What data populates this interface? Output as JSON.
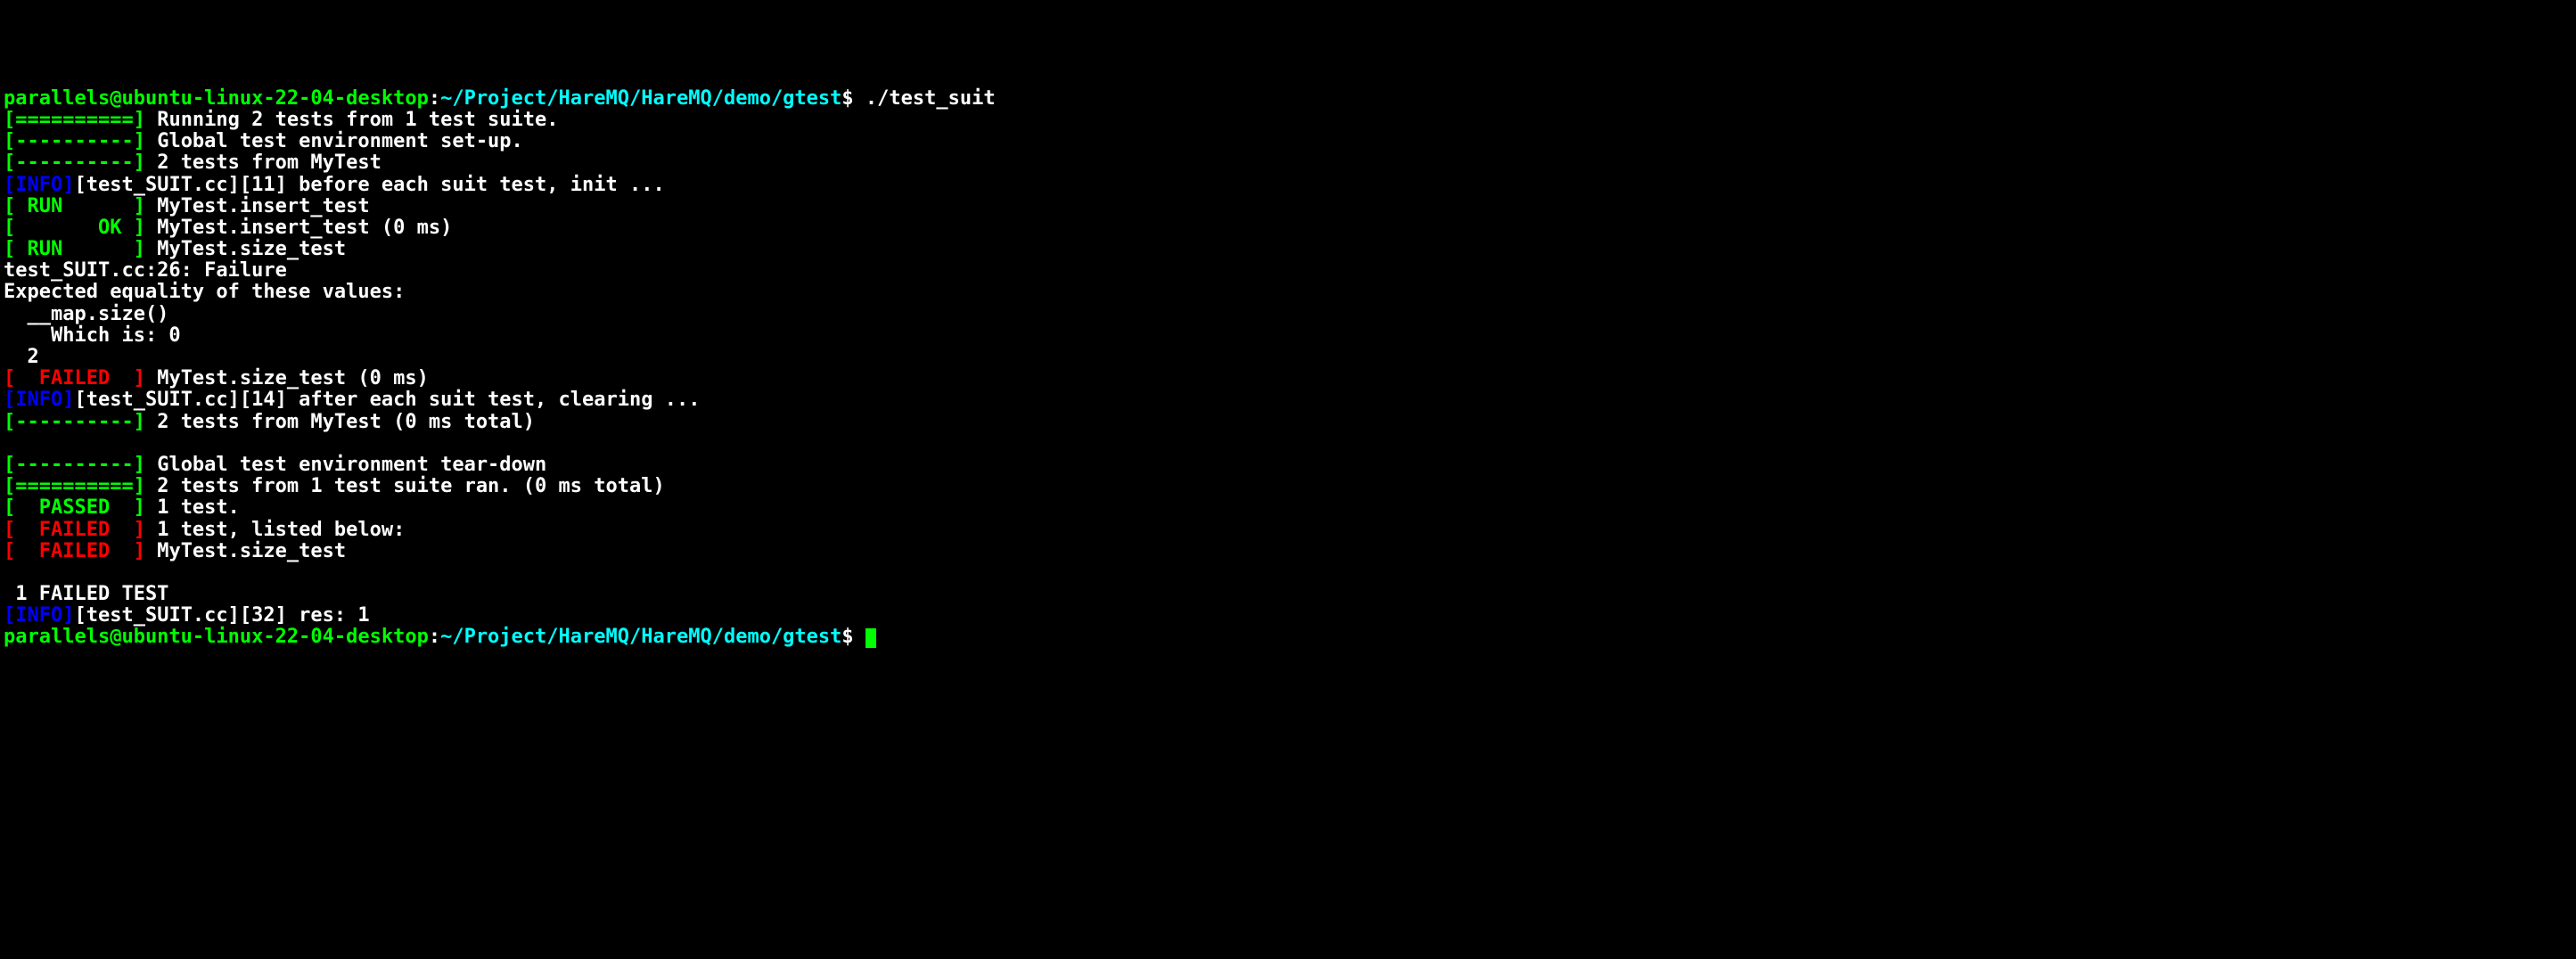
{
  "prompt1": {
    "user_host": "parallels@ubuntu-linux-22-04-desktop",
    "colon": ":",
    "path": "~/Project/HareMQ/HareMQ/demo/gtest",
    "dollar": "$ ",
    "command": "./test_suit"
  },
  "lines": {
    "running_bracket": "[==========]",
    "running_text": " Running 2 tests from 1 test suite.",
    "global_setup_bracket": "[----------]",
    "global_setup_text": " Global test environment set-up.",
    "tests_from_bracket": "[----------]",
    "tests_from_text": " 2 tests from MyTest",
    "info1_tag": "[INFO]",
    "info1_text": "[test_SUIT.cc][11] before each suit test, init ...",
    "run1_bracket": "[ RUN      ]",
    "run1_text": " MyTest.insert_test",
    "ok_bracket_l": "[       ",
    "ok_word": "OK",
    "ok_bracket_r": " ]",
    "ok_text": " MyTest.insert_test (0 ms)",
    "run2_bracket": "[ RUN      ]",
    "run2_text": " MyTest.size_test",
    "failure_loc": "test_SUIT.cc:26: Failure",
    "expected": "Expected equality of these values:",
    "mapsize": "  __map.size()",
    "whichis": "    Which is: 0",
    "two": "  2",
    "failed1_bracket": "[  FAILED  ]",
    "failed1_text": " MyTest.size_test (0 ms)",
    "info2_tag": "[INFO]",
    "info2_text": "[test_SUIT.cc][14] after each suit test, clearing ...",
    "tests_total_bracket": "[----------]",
    "tests_total_text": " 2 tests from MyTest (0 ms total)",
    "empty": "",
    "teardown_bracket": "[----------]",
    "teardown_text": " Global test environment tear-down",
    "ran_bracket": "[==========]",
    "ran_text": " 2 tests from 1 test suite ran. (0 ms total)",
    "passed_bracket": "[  PASSED  ]",
    "passed_text": " 1 test.",
    "failed2_bracket": "[  FAILED  ]",
    "failed2_text": " 1 test, listed below:",
    "failed3_bracket": "[  FAILED  ]",
    "failed3_text": " MyTest.size_test",
    "empty2": "",
    "failed_summary": " 1 FAILED TEST",
    "info3_tag": "[INFO]",
    "info3_text": "[test_SUIT.cc][32] res: 1"
  },
  "prompt2": {
    "user_host": "parallels@ubuntu-linux-22-04-desktop",
    "colon": ":",
    "path": "~/Project/HareMQ/HareMQ/demo/gtest",
    "dollar": "$ "
  }
}
